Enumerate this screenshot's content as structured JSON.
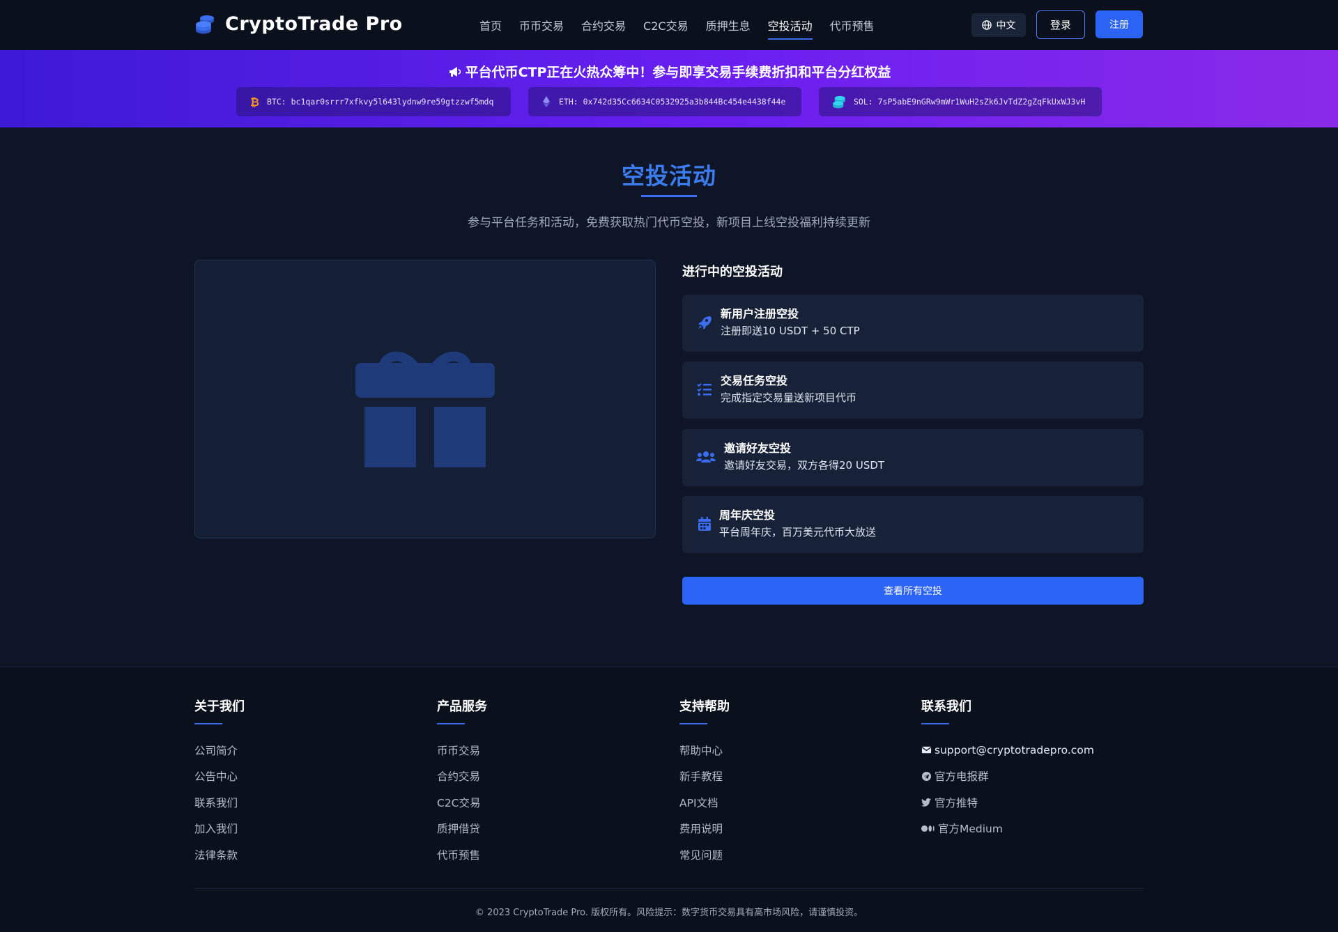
{
  "header": {
    "logo_text": "CryptoTrade Pro",
    "nav": [
      {
        "label": "首页",
        "active": false
      },
      {
        "label": "币币交易",
        "active": false
      },
      {
        "label": "合约交易",
        "active": false
      },
      {
        "label": "C2C交易",
        "active": false
      },
      {
        "label": "质押生息",
        "active": false
      },
      {
        "label": "空投活动",
        "active": true
      },
      {
        "label": "代币预售",
        "active": false
      }
    ],
    "lang_label": "中文",
    "login_label": "登录",
    "register_label": "注册"
  },
  "banner": {
    "title": "平台代币CTP正在火热众筹中！参与即享交易手续费折扣和平台分红权益",
    "addresses": {
      "btc": "BTC: bc1qar0srrr7xfkvy5l643lydnw9re59gtzzwf5mdq",
      "eth": "ETH: 0x742d35Cc6634C0532925a3b844Bc454e4438f44e",
      "sol": "SOL: 7sP5abE9nGRw9mWr1WuH2sZk6JvTdZ2gZqFkUxWJ3vH"
    }
  },
  "main": {
    "title": "空投活动",
    "subtitle": "参与平台任务和活动，免费获取热门代币空投，新项目上线空投福利持续更新",
    "list_title": "进行中的空投活动",
    "airdrops": [
      {
        "name": "新用户注册空投",
        "desc": "注册即送10 USDT + 50 CTP",
        "icon": "rocket-icon"
      },
      {
        "name": "交易任务空投",
        "desc": "完成指定交易量送新项目代币",
        "icon": "list-check-icon"
      },
      {
        "name": "邀请好友空投",
        "desc": "邀请好友交易，双方各得20 USDT",
        "icon": "users-icon"
      },
      {
        "name": "周年庆空投",
        "desc": "平台周年庆，百万美元代币大放送",
        "icon": "calendar-icon"
      }
    ],
    "view_all_label": "查看所有空投"
  },
  "footer": {
    "columns": [
      {
        "title": "关于我们",
        "links": [
          "公司简介",
          "公告中心",
          "联系我们",
          "加入我们",
          "法律条款"
        ]
      },
      {
        "title": "产品服务",
        "links": [
          "币币交易",
          "合约交易",
          "C2C交易",
          "质押借贷",
          "代币预售"
        ]
      },
      {
        "title": "支持帮助",
        "links": [
          "帮助中心",
          "新手教程",
          "API文档",
          "费用说明",
          "常见问题"
        ]
      },
      {
        "title": "联系我们",
        "links": [
          "support@cryptotradepro.com",
          "官方电报群",
          "官方推特",
          "官方Medium"
        ]
      }
    ],
    "copyright": "© 2023 CryptoTrade Pro. 版权所有。风险提示：数字货币交易具有高市场风险，请谨慎投资。"
  },
  "colors": {
    "accent": "#2b63f5",
    "title_blue": "#3d7cf0",
    "banner_start": "#3d1ad6",
    "banner_end": "#8a2ae8"
  }
}
